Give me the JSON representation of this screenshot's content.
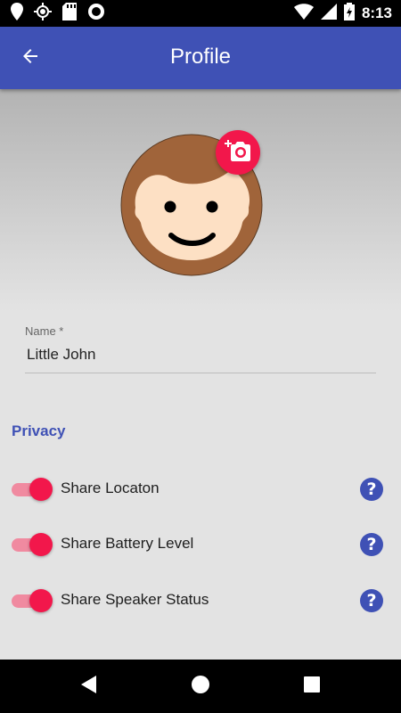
{
  "status_bar": {
    "time": "8:13",
    "left_icons": [
      "map-pin-icon",
      "gps-icon",
      "sd-card-icon",
      "record-icon"
    ],
    "right_icons": [
      "wifi-icon",
      "cellular-icon",
      "battery-charging-icon"
    ]
  },
  "app_bar": {
    "title": "Profile",
    "back_icon": "arrow-back-icon",
    "color": "#3f51b5"
  },
  "profile": {
    "avatar_icon": "avatar-face-icon",
    "change_photo_icon": "add-photo-camera-icon",
    "accent_color": "#f2174b"
  },
  "name_field": {
    "label": "Name *",
    "value": "Little John"
  },
  "privacy": {
    "title": "Privacy",
    "settings": [
      {
        "label": "Share Locaton",
        "enabled": true
      },
      {
        "label": "Share Battery Level",
        "enabled": true
      },
      {
        "label": "Share Speaker Status",
        "enabled": true
      }
    ],
    "help_text": "?"
  },
  "nav_bar": {
    "icons": [
      "back-triangle-icon",
      "home-circle-icon",
      "recents-square-icon"
    ]
  }
}
